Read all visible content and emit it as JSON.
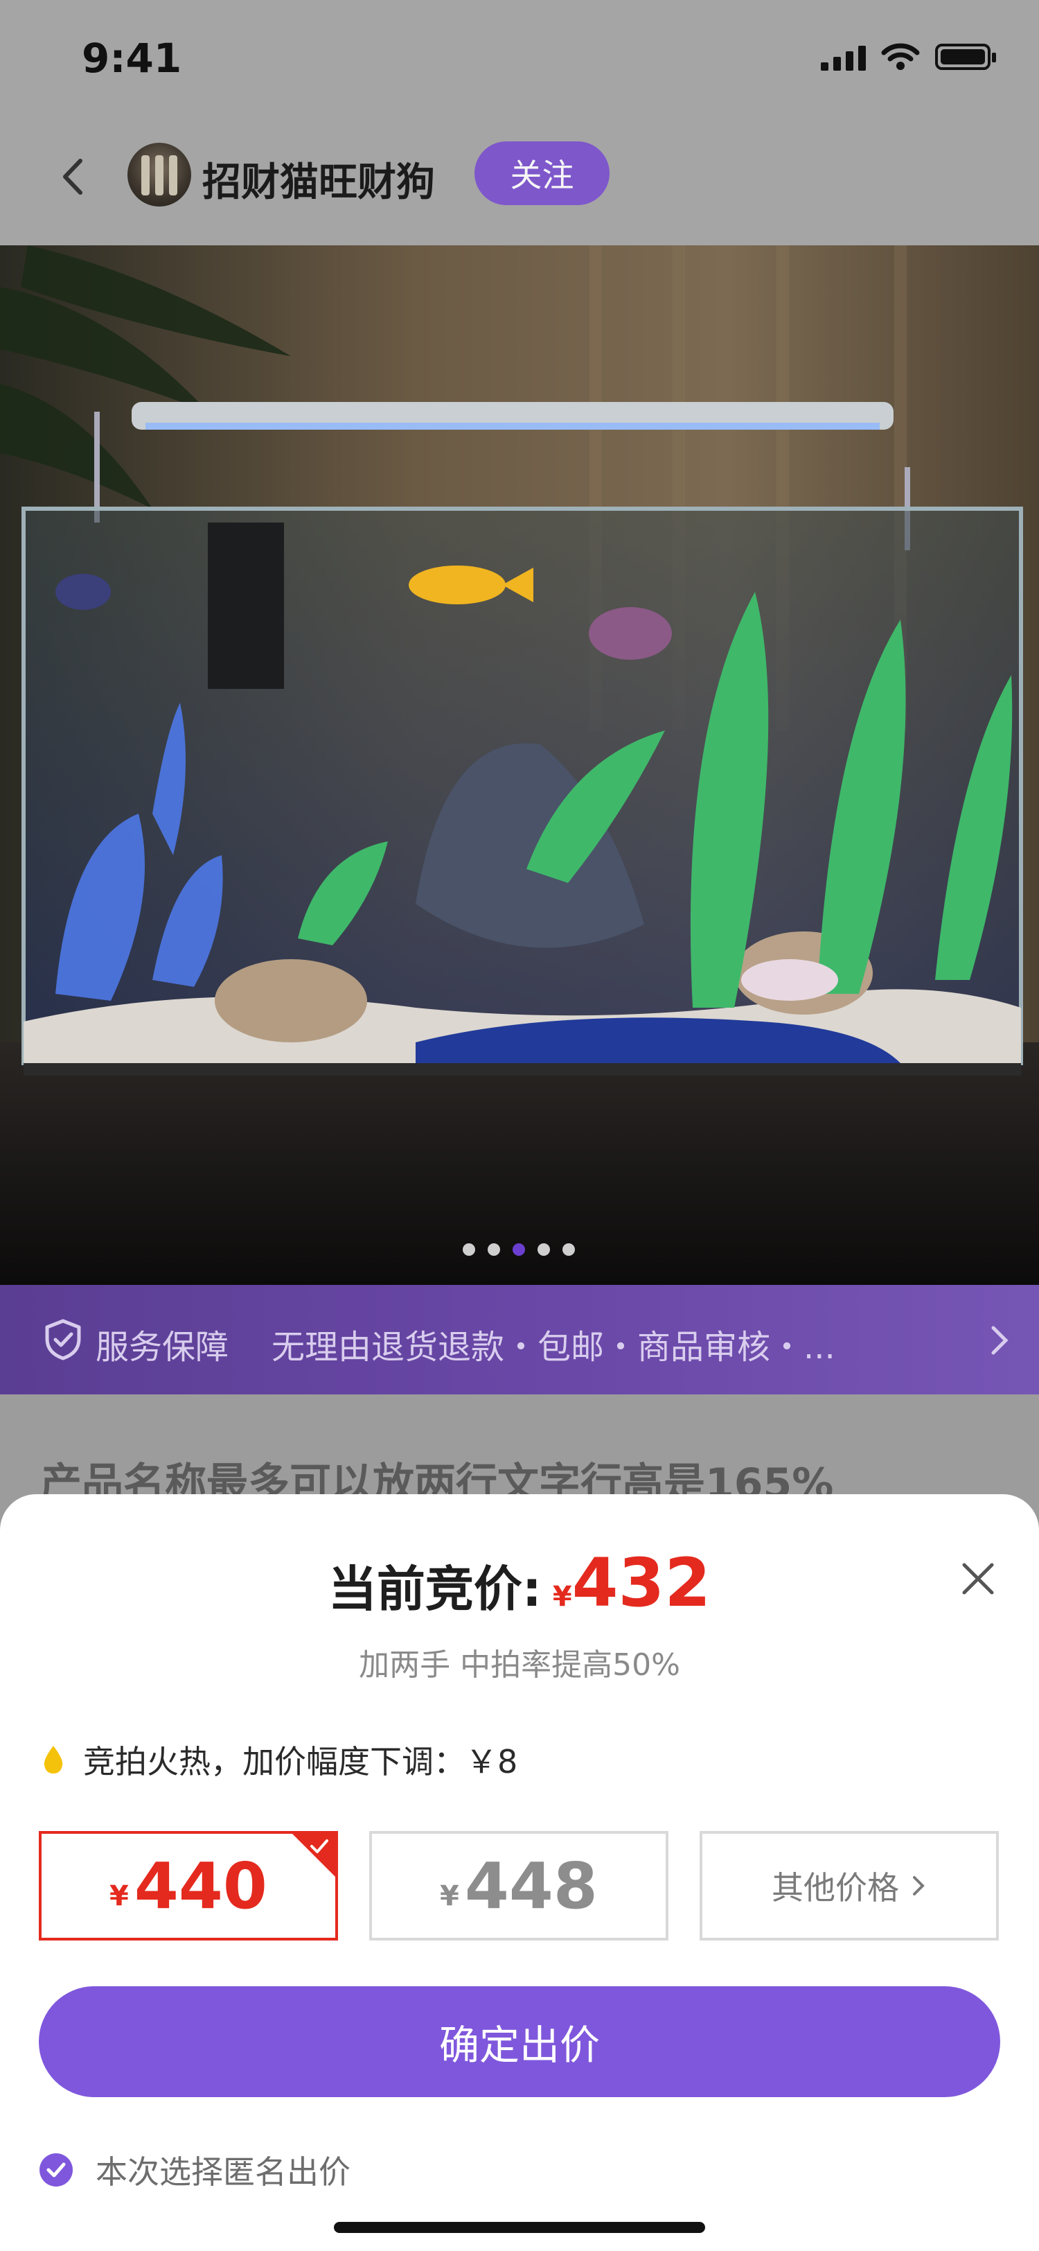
{
  "status_bar": {
    "time": "9:41"
  },
  "nav": {
    "store_name": "招财猫旺财狗",
    "follow_label": "关注"
  },
  "gallery": {
    "page_count": 5,
    "active_index": 2
  },
  "service": {
    "title": "服务保障",
    "items": "无理由退货退款・包邮・商品审核・..."
  },
  "product": {
    "title": "产品名称最多可以放两行文字行高是165%"
  },
  "bid_sheet": {
    "current_label": "当前竞价:",
    "currency": "¥",
    "current_price": "432",
    "subtext": "加两手 中拍率提高50%",
    "hot_text": "竞拍火热，加价幅度下调：￥8",
    "options": [
      {
        "currency": "¥",
        "amount": "440",
        "selected": true
      },
      {
        "currency": "¥",
        "amount": "448",
        "selected": false
      },
      {
        "label": "其他价格"
      }
    ],
    "confirm_label": "确定出价",
    "anonymous_label": "本次选择匿名出价"
  },
  "colors": {
    "accent": "#7f57dc",
    "price_red": "#e42a1e",
    "service_bar": "#5a3e93"
  }
}
